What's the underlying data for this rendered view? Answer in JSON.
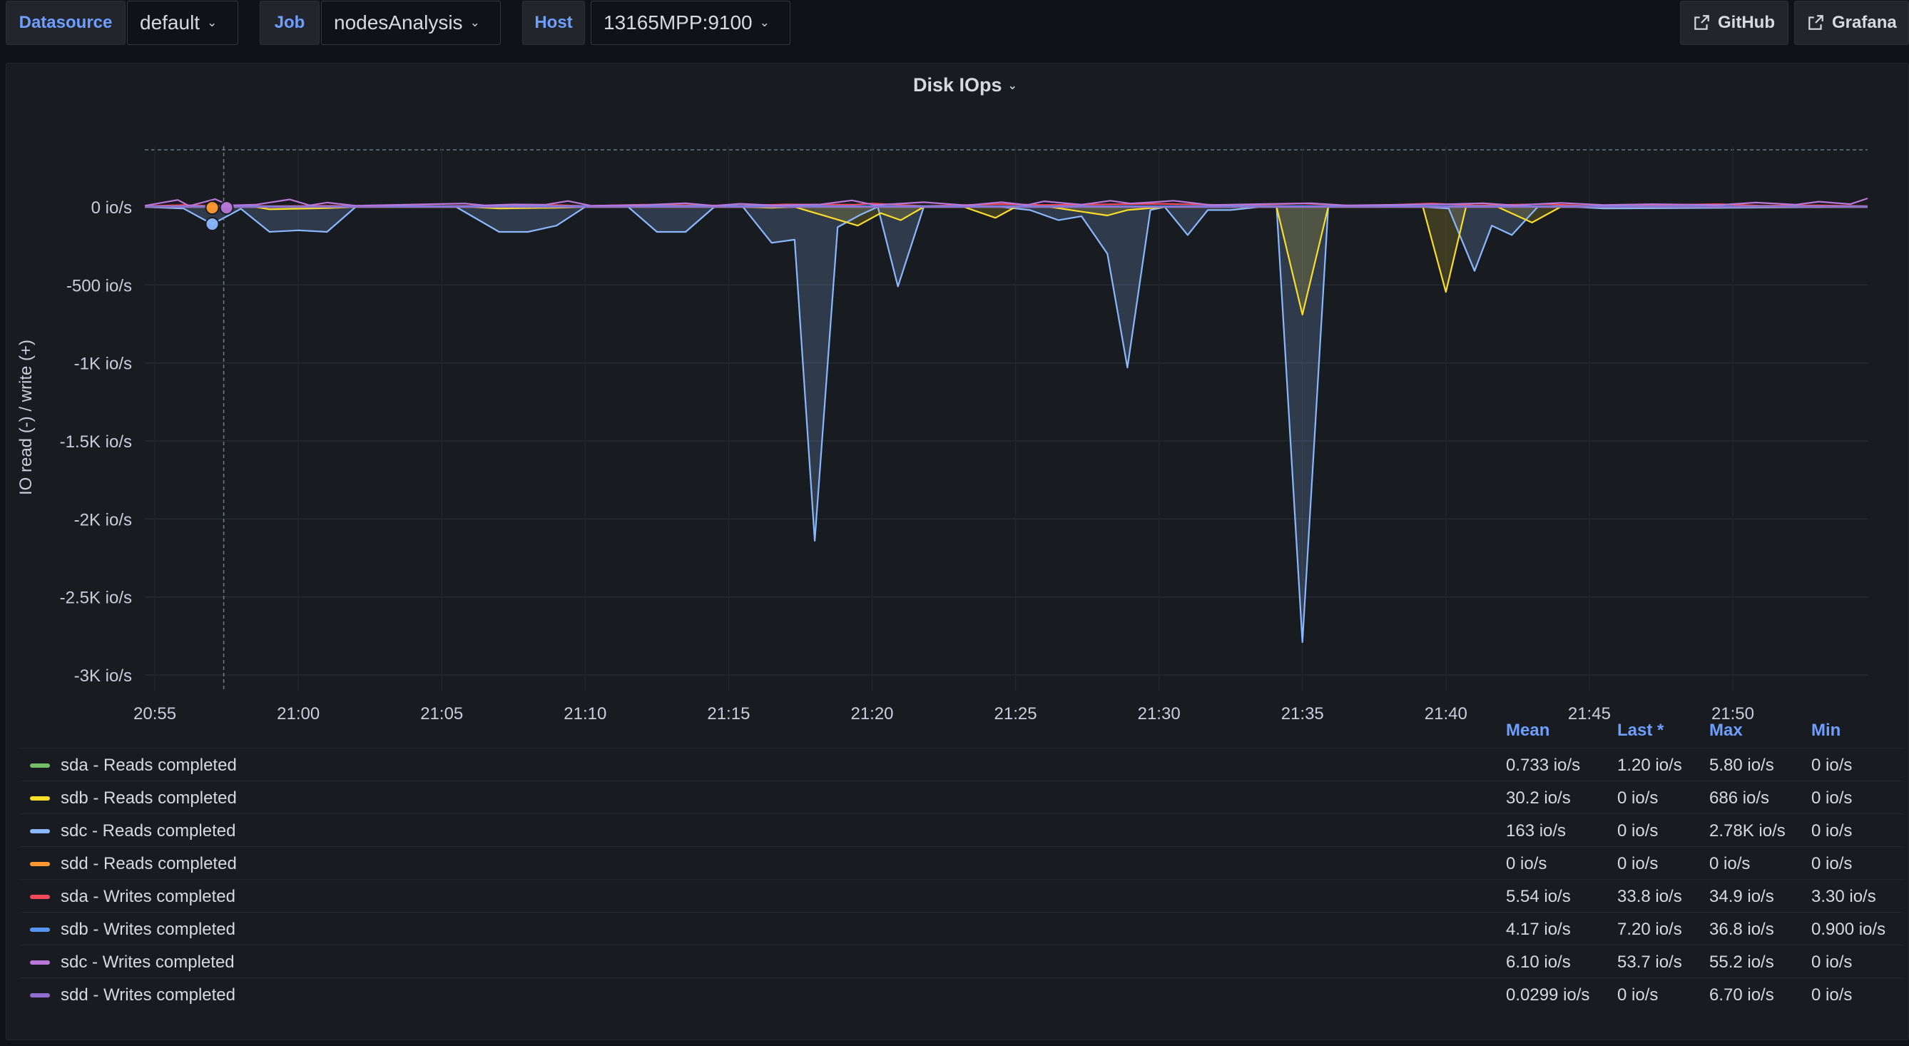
{
  "toolbar": {
    "datasource": {
      "label": "Datasource",
      "value": "default"
    },
    "job": {
      "label": "Job",
      "value": "nodesAnalysis"
    },
    "host": {
      "label": "Host",
      "value": "13165MPP:9100"
    },
    "links": [
      {
        "label": "GitHub",
        "icon": "external-link-icon"
      },
      {
        "label": "Grafana",
        "icon": "external-link-icon"
      }
    ]
  },
  "panel": {
    "title": "Disk IOps"
  },
  "colors": {
    "background": "#111217",
    "panel": "#181b1f",
    "accent_blue": "#6e9fff",
    "grid": "#2c3038"
  },
  "chart_data": {
    "type": "area",
    "title": "Disk IOps",
    "ylabel": "IO read (-) / write (+)",
    "yticks": [
      "0 io/s",
      "-500 io/s",
      "-1K io/s",
      "-1.5K io/s",
      "-2K io/s",
      "-2.5K io/s",
      "-3K io/s"
    ],
    "ytick_values": [
      0,
      -500,
      -1000,
      -1500,
      -2000,
      -2500,
      -3000
    ],
    "ylim": [
      -3100,
      380
    ],
    "xticks": [
      "20:55",
      "21:00",
      "21:05",
      "21:10",
      "21:15",
      "21:20",
      "21:25",
      "21:30",
      "21:35",
      "21:40",
      "21:45",
      "21:50"
    ],
    "xtick_minutes": [
      0,
      5,
      10,
      15,
      20,
      25,
      30,
      35,
      40,
      45,
      50,
      55
    ],
    "xlim_minutes": [
      -0.35,
      59.7
    ],
    "time_unit": "minutes after 20:55",
    "crosshair_minute": 2.4,
    "grid": true,
    "legend_placement": "bottom table",
    "series": [
      {
        "name": "sdc - Reads completed",
        "color": "#8ab8ff",
        "fill": "rgba(138,184,255,0.20)",
        "points": [
          [
            -0.35,
            0
          ],
          [
            1,
            -10
          ],
          [
            2,
            -110
          ],
          [
            3,
            -12
          ],
          [
            4,
            -160
          ],
          [
            5,
            -150
          ],
          [
            6,
            -160
          ],
          [
            7,
            0
          ],
          [
            10.5,
            0
          ],
          [
            12,
            -160
          ],
          [
            13,
            -160
          ],
          [
            14,
            -120
          ],
          [
            15,
            0
          ],
          [
            16.5,
            0
          ],
          [
            17.5,
            -160
          ],
          [
            18.5,
            -160
          ],
          [
            19.5,
            0
          ],
          [
            20.5,
            0
          ],
          [
            21.5,
            -230
          ],
          [
            22.3,
            -210
          ],
          [
            23,
            -2140
          ],
          [
            23.8,
            -130
          ],
          [
            24.6,
            -50
          ],
          [
            25.2,
            0
          ],
          [
            25.9,
            -510
          ],
          [
            26.8,
            0
          ],
          [
            29.5,
            0
          ],
          [
            30.5,
            -20
          ],
          [
            31.5,
            -85
          ],
          [
            32.3,
            -60
          ],
          [
            33.2,
            -300
          ],
          [
            33.9,
            -1030
          ],
          [
            34.7,
            -20
          ],
          [
            35.2,
            0
          ],
          [
            36,
            -180
          ],
          [
            36.7,
            -20
          ],
          [
            37.5,
            -20
          ],
          [
            38.5,
            0
          ],
          [
            39.1,
            0
          ],
          [
            40.0,
            -2790
          ],
          [
            40.9,
            0
          ],
          [
            44.2,
            0
          ],
          [
            45.1,
            -10
          ],
          [
            46.0,
            -410
          ],
          [
            46.6,
            -120
          ],
          [
            47.3,
            -180
          ],
          [
            48.2,
            0
          ],
          [
            49.5,
            0
          ],
          [
            50.5,
            -10
          ],
          [
            59.7,
            0
          ]
        ]
      },
      {
        "name": "sdb - Reads completed",
        "color": "#fade2a",
        "fill": "rgba(250,222,42,0.16)",
        "points": [
          [
            -0.35,
            0
          ],
          [
            3.5,
            0
          ],
          [
            4,
            -15
          ],
          [
            6,
            -8
          ],
          [
            7,
            0
          ],
          [
            11,
            0
          ],
          [
            12,
            -10
          ],
          [
            14,
            -5
          ],
          [
            15,
            0
          ],
          [
            20.5,
            0
          ],
          [
            21.5,
            -5
          ],
          [
            22.3,
            0
          ],
          [
            23.4,
            -60
          ],
          [
            24.5,
            -120
          ],
          [
            25.3,
            -40
          ],
          [
            26.0,
            -85
          ],
          [
            26.8,
            0
          ],
          [
            28.2,
            0
          ],
          [
            29.3,
            -70
          ],
          [
            30,
            0
          ],
          [
            31.2,
            0
          ],
          [
            33.2,
            -55
          ],
          [
            33.9,
            -20
          ],
          [
            35.2,
            0
          ],
          [
            39.1,
            0
          ],
          [
            40.0,
            -690
          ],
          [
            40.9,
            0
          ],
          [
            44.2,
            0
          ],
          [
            45.0,
            -545
          ],
          [
            45.7,
            0
          ],
          [
            46.8,
            0
          ],
          [
            48.0,
            -100
          ],
          [
            49.0,
            0
          ],
          [
            59.7,
            0
          ]
        ]
      },
      {
        "name": "sda - Reads completed",
        "color": "#73bf69",
        "fill": "none",
        "points": [
          [
            -0.35,
            0
          ],
          [
            59.7,
            0
          ]
        ]
      },
      {
        "name": "sdd - Reads completed",
        "color": "#ff9830",
        "fill": "none",
        "points": [
          [
            -0.35,
            0
          ],
          [
            59.7,
            0
          ]
        ]
      },
      {
        "name": "sda - Writes completed",
        "color": "#f2495c",
        "fill": "none",
        "points": [
          [
            -0.35,
            5
          ],
          [
            1,
            12
          ],
          [
            2,
            6
          ],
          [
            3,
            10
          ],
          [
            4,
            5
          ],
          [
            6,
            8
          ],
          [
            7,
            6
          ],
          [
            10,
            6
          ],
          [
            12,
            8
          ],
          [
            14,
            12
          ],
          [
            15,
            6
          ],
          [
            17,
            14
          ],
          [
            20.5,
            8
          ],
          [
            22,
            16
          ],
          [
            24.4,
            14
          ],
          [
            25,
            22
          ],
          [
            26.8,
            6
          ],
          [
            29.5,
            18
          ],
          [
            31,
            12
          ],
          [
            33,
            16
          ],
          [
            35,
            20
          ],
          [
            38,
            10
          ],
          [
            40,
            22
          ],
          [
            42,
            6
          ],
          [
            44.5,
            22
          ],
          [
            46,
            10
          ],
          [
            48.5,
            18
          ],
          [
            50,
            6
          ],
          [
            52.5,
            12
          ],
          [
            54.5,
            18
          ],
          [
            56,
            8
          ],
          [
            58,
            10
          ],
          [
            59.7,
            5
          ]
        ]
      },
      {
        "name": "sdb - Writes completed",
        "color": "#5794f2",
        "fill": "none",
        "points": [
          [
            -0.35,
            3
          ],
          [
            2,
            4
          ],
          [
            5,
            3
          ],
          [
            10,
            4
          ],
          [
            20,
            6
          ],
          [
            30,
            4
          ],
          [
            40,
            5
          ],
          [
            50,
            4
          ],
          [
            59.7,
            3
          ]
        ]
      },
      {
        "name": "sdc - Writes completed",
        "color": "#b877d9",
        "fill": "none",
        "points": [
          [
            -0.35,
            8
          ],
          [
            0.8,
            45
          ],
          [
            1.2,
            6
          ],
          [
            2.1,
            50
          ],
          [
            2.6,
            10
          ],
          [
            3.5,
            14
          ],
          [
            4.7,
            48
          ],
          [
            5.4,
            10
          ],
          [
            6,
            28
          ],
          [
            7,
            8
          ],
          [
            10.8,
            22
          ],
          [
            11.5,
            10
          ],
          [
            12.5,
            16
          ],
          [
            13.6,
            14
          ],
          [
            14.4,
            38
          ],
          [
            15.2,
            8
          ],
          [
            17,
            12
          ],
          [
            18.5,
            24
          ],
          [
            19.5,
            8
          ],
          [
            20.4,
            20
          ],
          [
            21.6,
            10
          ],
          [
            23.2,
            16
          ],
          [
            24.3,
            42
          ],
          [
            25.1,
            12
          ],
          [
            26.8,
            30
          ],
          [
            28.3,
            10
          ],
          [
            29.5,
            30
          ],
          [
            30.4,
            12
          ],
          [
            31,
            36
          ],
          [
            32.3,
            14
          ],
          [
            33.3,
            40
          ],
          [
            34,
            22
          ],
          [
            34.8,
            30
          ],
          [
            35.5,
            40
          ],
          [
            36.8,
            12
          ],
          [
            38.4,
            18
          ],
          [
            40.3,
            24
          ],
          [
            41.5,
            10
          ],
          [
            43.5,
            14
          ],
          [
            45.2,
            18
          ],
          [
            46.3,
            24
          ],
          [
            47.4,
            10
          ],
          [
            49.0,
            26
          ],
          [
            50.5,
            12
          ],
          [
            52.2,
            18
          ],
          [
            54.5,
            12
          ],
          [
            55.8,
            28
          ],
          [
            57.2,
            14
          ],
          [
            58,
            34
          ],
          [
            59.1,
            18
          ],
          [
            59.7,
            55
          ]
        ]
      },
      {
        "name": "sdd - Writes completed",
        "color": "#8f6ecf",
        "fill": "none",
        "points": [
          [
            -0.35,
            0
          ],
          [
            59.7,
            0
          ]
        ]
      }
    ],
    "hover_markers": [
      {
        "x": 2.0,
        "y": -5,
        "color": "#ff9830"
      },
      {
        "x": 2.0,
        "y": -110,
        "color": "#8ab8ff"
      },
      {
        "x": 2.5,
        "y": -5,
        "color": "#b877d9"
      }
    ]
  },
  "legend": {
    "columns": [
      "Mean",
      "Last *",
      "Max",
      "Min"
    ],
    "rows": [
      {
        "name": "sda - Reads completed",
        "color": "#73bf69",
        "mean": "0.733 io/s",
        "last": "1.20 io/s",
        "max": "5.80 io/s",
        "min": "0 io/s"
      },
      {
        "name": "sdb - Reads completed",
        "color": "#fade2a",
        "mean": "30.2 io/s",
        "last": "0 io/s",
        "max": "686 io/s",
        "min": "0 io/s"
      },
      {
        "name": "sdc - Reads completed",
        "color": "#8ab8ff",
        "mean": "163 io/s",
        "last": "0 io/s",
        "max": "2.78K io/s",
        "min": "0 io/s"
      },
      {
        "name": "sdd - Reads completed",
        "color": "#ff9830",
        "mean": "0 io/s",
        "last": "0 io/s",
        "max": "0 io/s",
        "min": "0 io/s"
      },
      {
        "name": "sda - Writes completed",
        "color": "#f2495c",
        "mean": "5.54 io/s",
        "last": "33.8 io/s",
        "max": "34.9 io/s",
        "min": "3.30 io/s"
      },
      {
        "name": "sdb - Writes completed",
        "color": "#5794f2",
        "mean": "4.17 io/s",
        "last": "7.20 io/s",
        "max": "36.8 io/s",
        "min": "0.900 io/s"
      },
      {
        "name": "sdc - Writes completed",
        "color": "#b877d9",
        "mean": "6.10 io/s",
        "last": "53.7 io/s",
        "max": "55.2 io/s",
        "min": "0 io/s"
      },
      {
        "name": "sdd - Writes completed",
        "color": "#8f6ecf",
        "mean": "0.0299 io/s",
        "last": "0 io/s",
        "max": "6.70 io/s",
        "min": "0 io/s"
      }
    ]
  }
}
